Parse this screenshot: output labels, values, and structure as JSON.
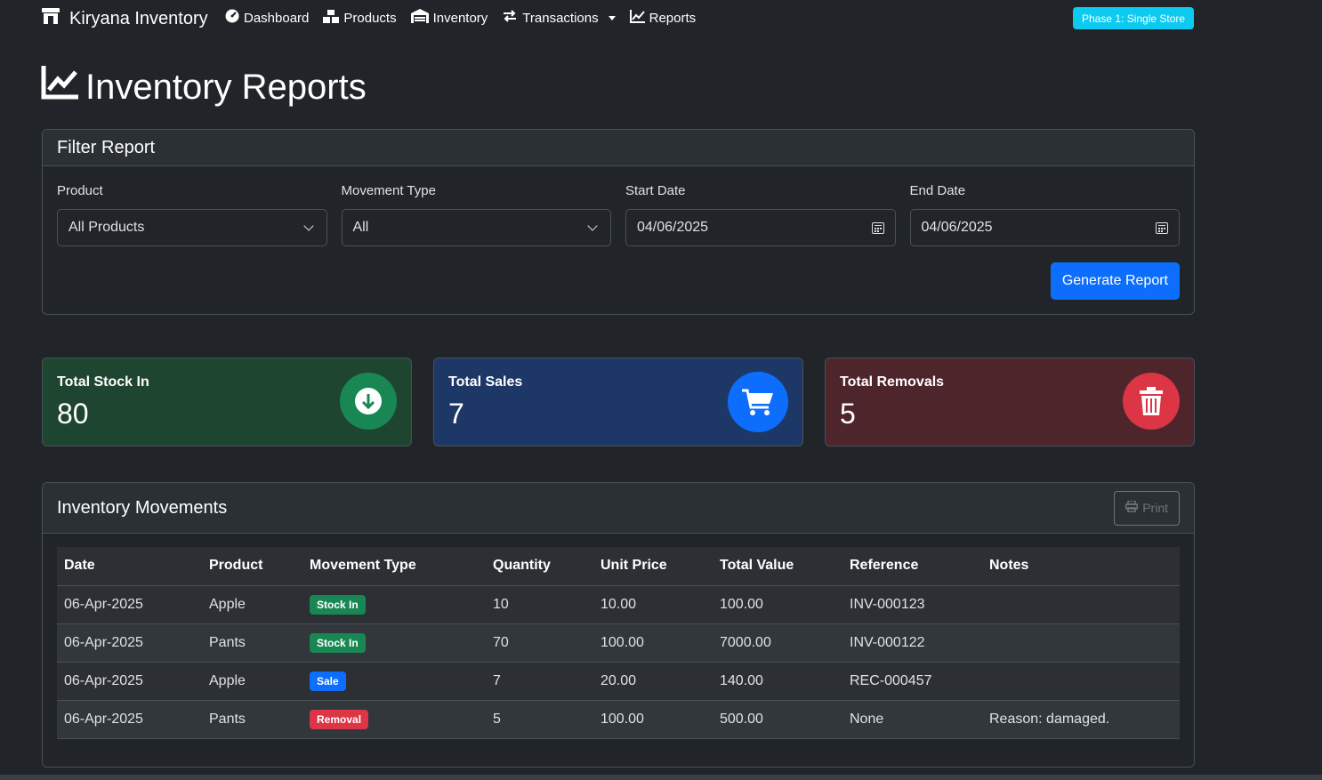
{
  "nav": {
    "brand": "Kiryana Inventory",
    "links": [
      {
        "label": "Dashboard",
        "icon": "dashboard-icon"
      },
      {
        "label": "Products",
        "icon": "boxes-icon"
      },
      {
        "label": "Inventory",
        "icon": "warehouse-icon"
      },
      {
        "label": "Transactions",
        "icon": "exchange-icon"
      },
      {
        "label": "Reports",
        "icon": "chart-line-icon"
      }
    ],
    "phase_badge": "Phase 1: Single Store"
  },
  "page_title": "Inventory Reports",
  "filter": {
    "title": "Filter Report",
    "product_label": "Product",
    "product_value": "All Products",
    "movement_label": "Movement Type",
    "movement_value": "All",
    "start_label": "Start Date",
    "start_value": "04/06/2025",
    "end_label": "End Date",
    "end_value": "04/06/2025",
    "generate_label": "Generate Report"
  },
  "stats": {
    "stock_in": {
      "label": "Total Stock In",
      "value": "80",
      "color": "#198754"
    },
    "sales": {
      "label": "Total Sales",
      "value": "7",
      "color": "#0d6efd"
    },
    "removals": {
      "label": "Total Removals",
      "value": "5",
      "color": "#dc3545"
    }
  },
  "movements": {
    "title": "Inventory Movements",
    "print_label": "Print",
    "columns": [
      "Date",
      "Product",
      "Movement Type",
      "Quantity",
      "Unit Price",
      "Total Value",
      "Reference",
      "Notes"
    ],
    "rows": [
      {
        "date": "06-Apr-2025",
        "product": "Apple",
        "type": "Stock In",
        "type_class": "b-in",
        "qty": "10",
        "unit": "10.00",
        "total": "100.00",
        "ref": "INV-000123",
        "notes": ""
      },
      {
        "date": "06-Apr-2025",
        "product": "Pants",
        "type": "Stock In",
        "type_class": "b-in",
        "qty": "70",
        "unit": "100.00",
        "total": "7000.00",
        "ref": "INV-000122",
        "notes": ""
      },
      {
        "date": "06-Apr-2025",
        "product": "Apple",
        "type": "Sale",
        "type_class": "b-sale",
        "qty": "7",
        "unit": "20.00",
        "total": "140.00",
        "ref": "REC-000457",
        "notes": ""
      },
      {
        "date": "06-Apr-2025",
        "product": "Pants",
        "type": "Removal",
        "type_class": "b-rem",
        "qty": "5",
        "unit": "100.00",
        "total": "500.00",
        "ref": "None",
        "notes": "Reason: damaged."
      }
    ]
  }
}
